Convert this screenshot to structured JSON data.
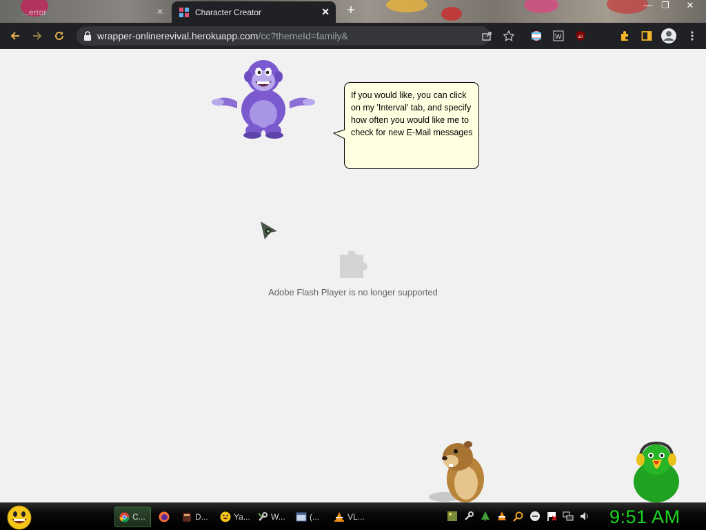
{
  "browser": {
    "tabs": [
      {
        "title": "...error",
        "active": false
      },
      {
        "title": "Character Creator",
        "active": true
      }
    ],
    "url": {
      "host": "wrapper-onlinerevival.herokuapp.com",
      "path": "/cc?themeId=family&"
    },
    "icons": [
      "back-arrow-icon",
      "forward-arrow-icon",
      "reload-icon",
      "lock-icon",
      "share-icon",
      "star-icon",
      "extension-icon",
      "puzzle-icon",
      "sidebar-icon",
      "profile-icon"
    ]
  },
  "page": {
    "plugin_message": "Adobe Flash Player is no longer supported",
    "bubble_text": "If you would like, you can click on my 'Interval' tab, and specify how often you would like me to check for new E-Mail messages"
  },
  "taskbar": {
    "tasks": [
      {
        "label": "C...",
        "icon": "chrome-icon"
      },
      {
        "label": "",
        "icon": "firefox-icon"
      },
      {
        "label": "D...",
        "icon": "app-icon"
      },
      {
        "label": "Ya...",
        "icon": "smiley-icon"
      },
      {
        "label": "W...",
        "icon": "wrench-icon"
      },
      {
        "label": "(...",
        "icon": "window-icon"
      },
      {
        "label": "VL...",
        "icon": "vlc-icon"
      }
    ],
    "clock": "9:51 AM"
  },
  "colors": {
    "toolbar": "#202124",
    "page_bg": "#f1f1f1",
    "bubble_bg": "#ffffe1",
    "bonzi_purple": "#7b5ad0",
    "clock_green": "#19d61f"
  }
}
